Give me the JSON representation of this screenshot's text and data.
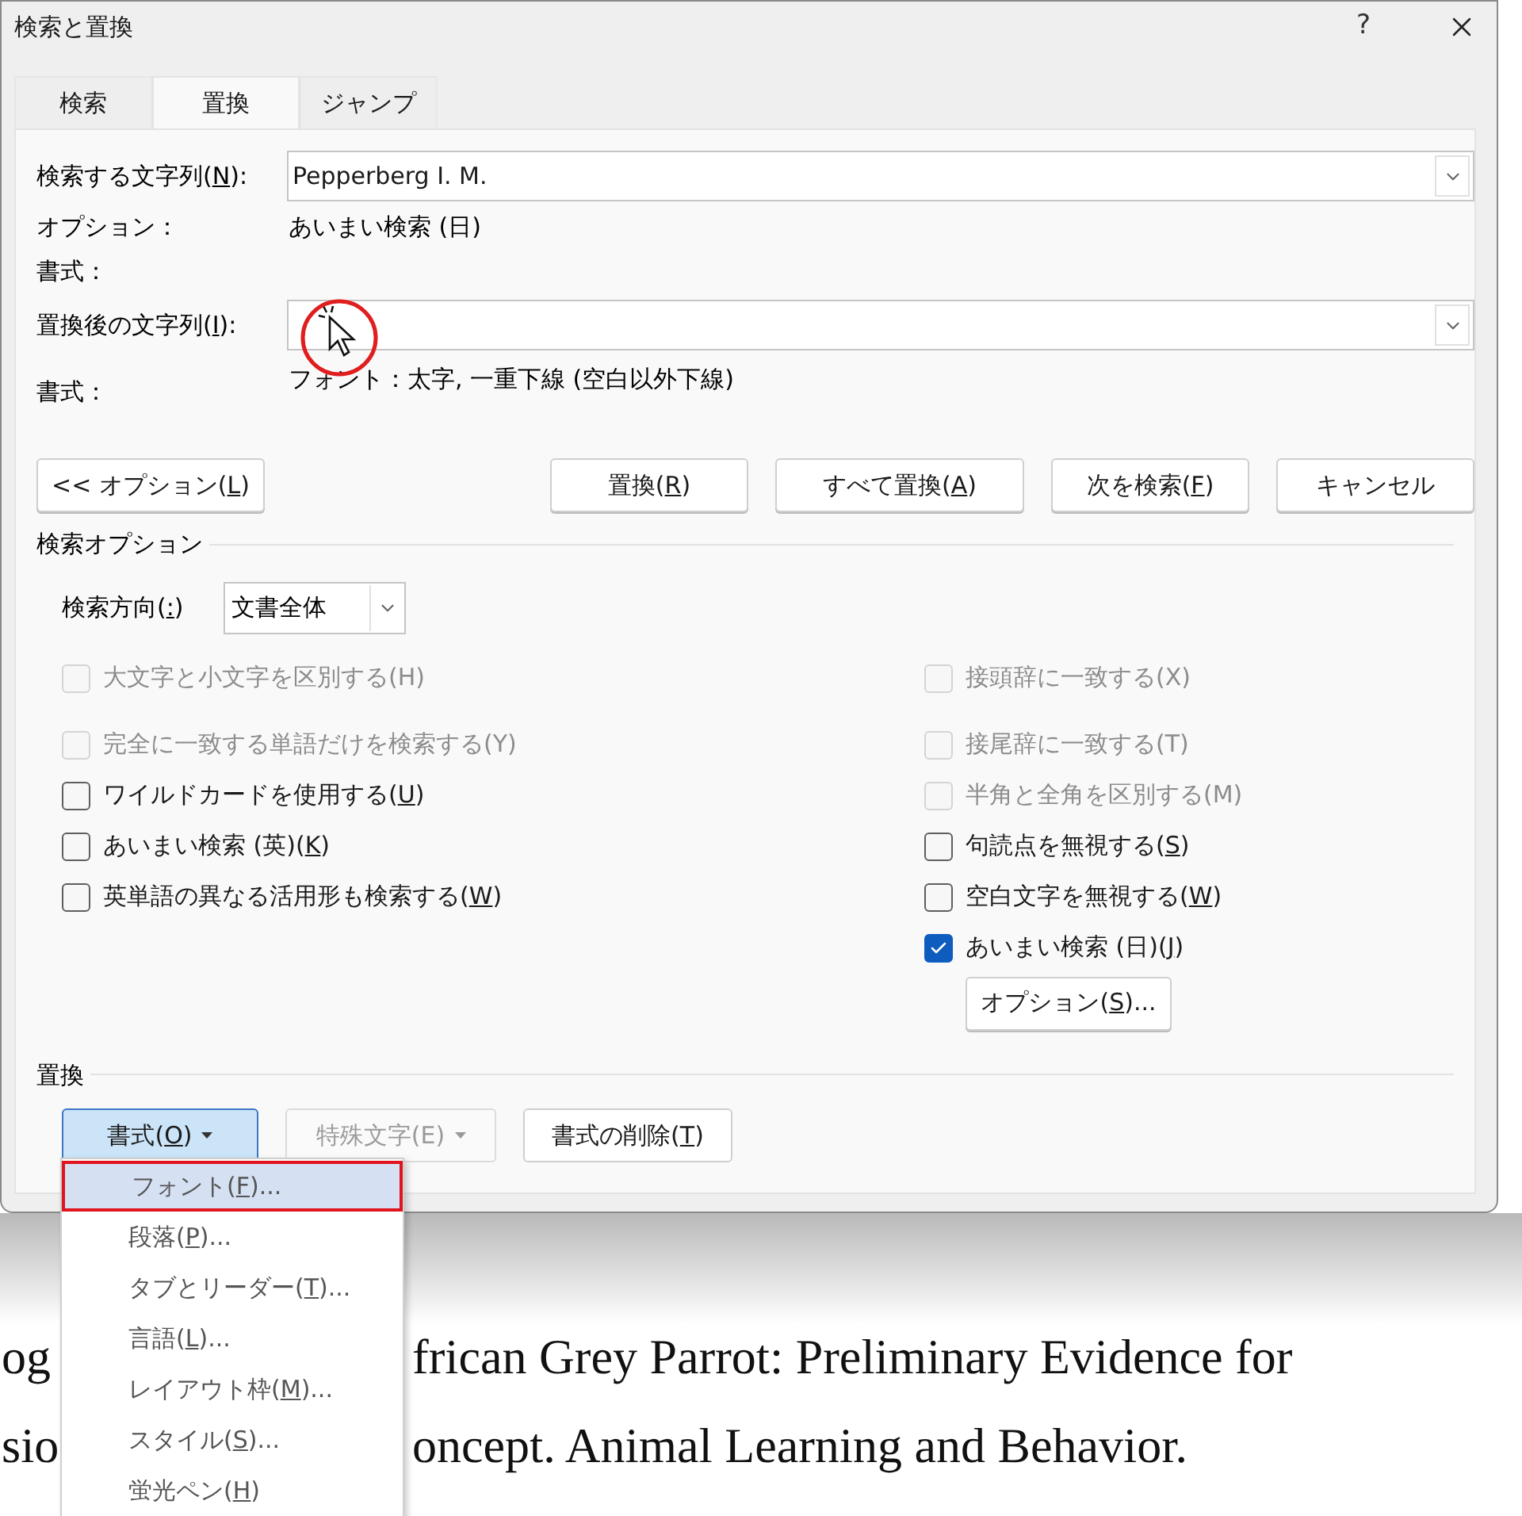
{
  "window": {
    "title": "検索と置換",
    "help": "?"
  },
  "tabs": [
    {
      "label": "検索",
      "selected": false
    },
    {
      "label": "置換",
      "selected": true
    },
    {
      "label": "ジャンプ",
      "selected": false
    }
  ],
  "find": {
    "label": {
      "pre": "検索する文字列(",
      "key": "N",
      "post": "):"
    },
    "value": "Pepperberg I. M.",
    "options_label": "オプション：",
    "options_value": "あいまい検索 (日)",
    "format_label": "書式："
  },
  "replace": {
    "label": {
      "pre": "置換後の文字列(",
      "key": "I",
      "post": "):"
    },
    "format_label": "書式：",
    "format_value": "フォント：太字, 一重下線 (空白以外下線)"
  },
  "less_button": {
    "pre": "<< オプション(",
    "key": "L",
    "post": ")"
  },
  "action_buttons": [
    {
      "pre": "置換(",
      "key": "R",
      "post": ")"
    },
    {
      "pre": "すべて置換(",
      "key": "A",
      "post": ")"
    },
    {
      "pre": "次を検索(",
      "key": "F",
      "post": ")"
    },
    {
      "pre": "キャンセル"
    }
  ],
  "search_options": {
    "heading": "検索オプション",
    "direction_label": {
      "pre": "検索方向(",
      "key": ":",
      "post": ")"
    },
    "direction_value": "文書全体",
    "left": [
      {
        "label": {
          "pre": "大文字と小文字を区別する(H)"
        },
        "checked": false,
        "disabled": true
      },
      {
        "label": {
          "pre": "完全に一致する単語だけを検索する(Y)"
        },
        "checked": false,
        "disabled": true
      },
      {
        "label": {
          "pre": "ワイルドカードを使用する(",
          "key": "U",
          "post": ")"
        },
        "checked": false,
        "disabled": false
      },
      {
        "label": {
          "pre": "あいまい検索 (英)(",
          "key": "K",
          "post": ")"
        },
        "checked": false,
        "disabled": false
      },
      {
        "label": {
          "pre": "英単語の異なる活用形も検索する(",
          "key": "W",
          "post": ")"
        },
        "checked": false,
        "disabled": false
      }
    ],
    "right": [
      {
        "label": {
          "pre": "接頭辞に一致する(X)"
        },
        "checked": false,
        "disabled": true
      },
      {
        "label": {
          "pre": "接尾辞に一致する(T)"
        },
        "checked": false,
        "disabled": true
      },
      {
        "label": {
          "pre": "半角と全角を区別する(M)"
        },
        "checked": false,
        "disabled": true
      },
      {
        "label": {
          "pre": "句読点を無視する(",
          "key": "S",
          "post": ")"
        },
        "checked": false,
        "disabled": false
      },
      {
        "label": {
          "pre": "空白文字を無視する(",
          "key": "W",
          "post": ")"
        },
        "checked": false,
        "disabled": false
      },
      {
        "label": {
          "pre": "あいまい検索 (日)(",
          "key": "J",
          "post": ")"
        },
        "checked": true,
        "disabled": false
      }
    ],
    "options_button": {
      "pre": "オプション(",
      "key": "S",
      "post": ")..."
    }
  },
  "replace_section": {
    "heading": "置換",
    "buttons": [
      {
        "label": {
          "pre": "書式(",
          "key": "O",
          "post": ")"
        },
        "caret": true,
        "pressed": true,
        "disabled": false
      },
      {
        "label": {
          "pre": "特殊文字(E)"
        },
        "caret": true,
        "pressed": false,
        "disabled": true
      },
      {
        "label": {
          "pre": "書式の削除(",
          "key": "T",
          "post": ")"
        },
        "caret": false,
        "pressed": false,
        "disabled": false
      }
    ]
  },
  "format_menu": [
    {
      "label": {
        "pre": "フォント(",
        "key": "F",
        "post": ")..."
      },
      "selected": true
    },
    {
      "label": {
        "pre": "段落(",
        "key": "P",
        "post": ")..."
      },
      "selected": false
    },
    {
      "label": {
        "pre": "タブとリーダー(",
        "key": "T",
        "post": ")..."
      },
      "selected": false
    },
    {
      "label": {
        "pre": "言語(",
        "key": "L",
        "post": ")..."
      },
      "selected": false
    },
    {
      "label": {
        "pre": "レイアウト枠(",
        "key": "M",
        "post": ")..."
      },
      "selected": false
    },
    {
      "label": {
        "pre": "スタイル(",
        "key": "S",
        "post": ")..."
      },
      "selected": false
    },
    {
      "label": {
        "pre": "蛍光ペン(",
        "key": "H",
        "post": ")"
      },
      "selected": false
    }
  ],
  "document": [
    {
      "left": "og",
      "right": "frican Grey Parrot: Preliminary Evidence for"
    },
    {
      "left": "sio",
      "right": "oncept. Animal Learning and Behavior."
    }
  ]
}
